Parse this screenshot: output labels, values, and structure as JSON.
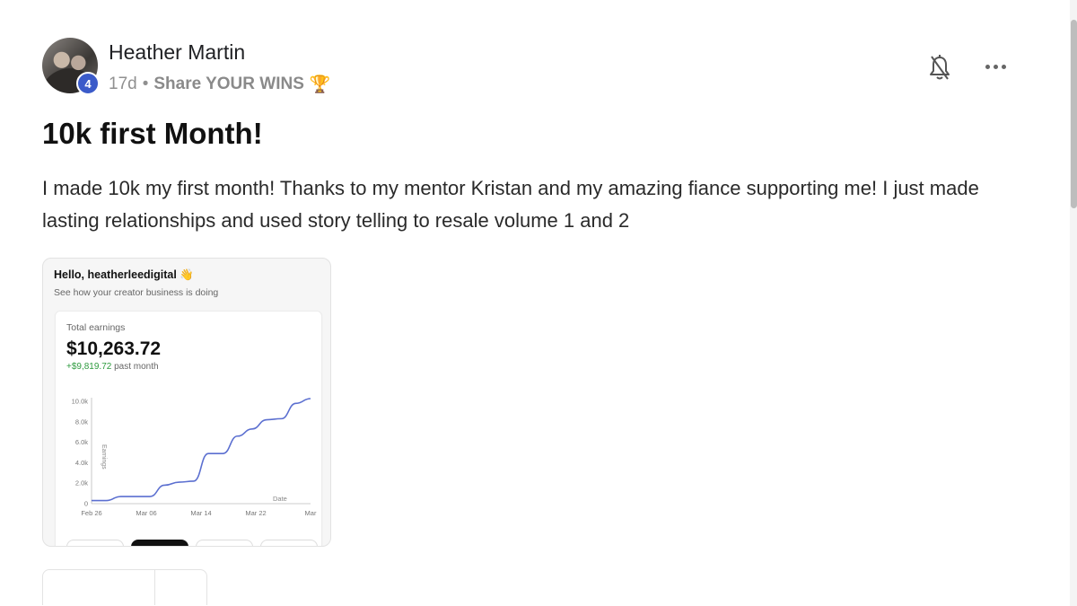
{
  "post": {
    "author": "Heather Martin",
    "level": "4",
    "time_ago": "17d",
    "separator": "•",
    "category": "Share YOUR WINS",
    "category_icon": "trophy-icon",
    "title": "10k first Month!",
    "body": "I made 10k my first month! Thanks to my mentor Kristan and my amazing fiance supporting me! I just made lasting relationships and used story telling to resale volume 1 and 2"
  },
  "attachment": {
    "greeting": "Hello, heatherleedigital 👋",
    "subtitle": "See how your creator business is doing",
    "earnings_label": "Total earnings",
    "earnings_value": "$10,263.72",
    "delta_value": "+$9,819.72",
    "delta_suffix": " past month",
    "accent_color": "#5b6fd0",
    "positive_color": "#2e9b3f"
  },
  "chart_data": {
    "type": "line",
    "x": [
      "Feb 26",
      "Feb 28",
      "Mar 01",
      "Mar 03",
      "Mar 05",
      "Mar 06",
      "Mar 08",
      "Mar 10",
      "Mar 12",
      "Mar 14",
      "Mar 16",
      "Mar 18",
      "Mar 20",
      "Mar 22",
      "Mar 24",
      "Mar 26"
    ],
    "values": [
      300,
      300,
      700,
      700,
      700,
      1800,
      2100,
      2200,
      4900,
      4900,
      6600,
      7300,
      8200,
      8300,
      9800,
      10263
    ],
    "x_tick_labels": [
      "Feb 26",
      "Mar 06",
      "Mar 14",
      "Mar 22",
      "Mar"
    ],
    "y_tick_labels": [
      "0",
      "2.0k",
      "4.0k",
      "6.0k",
      "8.0k",
      "10.0k"
    ],
    "ylim": [
      0,
      10000
    ],
    "xlabel": "Date",
    "ylabel": "Earnings",
    "grid": false,
    "color": "#5b6fd0"
  },
  "colors": {
    "badge": "#3b5bc9",
    "title": "#111111",
    "meta": "#909090"
  },
  "icons": {
    "notification": "bell-off-icon",
    "more": "more-horizontal-icon"
  }
}
